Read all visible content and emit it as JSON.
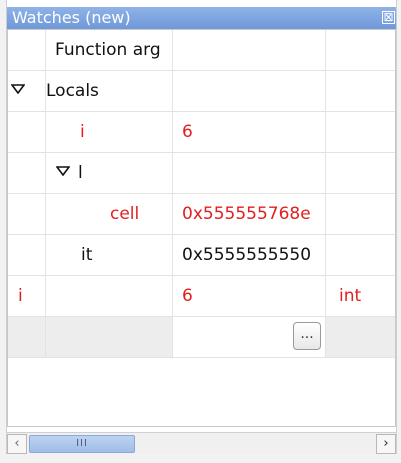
{
  "window": {
    "title": "Watches (new)",
    "close_glyph": "⊠"
  },
  "rows": {
    "function_args": {
      "name": "Function arg"
    },
    "locals": {
      "name": "Locals"
    },
    "local_i": {
      "name": "i",
      "value": "6"
    },
    "l_group": {
      "name": "l"
    },
    "cell": {
      "name": "cell",
      "value": "0x555555768e"
    },
    "it": {
      "name": "it",
      "value": "0x5555555550"
    },
    "watch_i": {
      "name": "i",
      "value": "6",
      "type": "int"
    }
  },
  "actions": {
    "ellipsis_label": "..."
  },
  "hscroll": {
    "thumb_grip": "III",
    "left_arrow": "‹",
    "right_arrow": "›"
  },
  "colors": {
    "titlebar": "#7aa2dd",
    "changed_value": "#e02020",
    "empty_row": "#ededed"
  },
  "icons": {
    "expanded": "triangle-down-icon",
    "close": "close-icon"
  }
}
